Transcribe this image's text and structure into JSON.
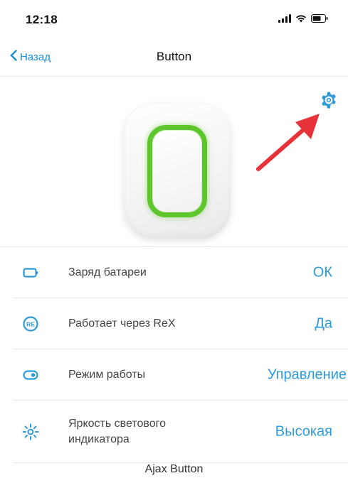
{
  "status_bar": {
    "time": "12:18",
    "icons": [
      "signal-icon",
      "wifi-icon",
      "battery-icon"
    ]
  },
  "nav": {
    "back_label": "Назад",
    "title": "Button"
  },
  "hero": {
    "device_icon": "ajax-button-device",
    "settings_icon": "gear-icon",
    "annotation_icon": "red-arrow-icon"
  },
  "settings": [
    {
      "icon": "battery-outline-icon",
      "label": "Заряд батареи",
      "value": "ОК"
    },
    {
      "icon": "rex-icon",
      "label": "Работает через ReX",
      "value": "Да"
    },
    {
      "icon": "toggle-icon",
      "label": "Режим работы",
      "value": "Управление"
    },
    {
      "icon": "brightness-icon",
      "label": "Яркость светового индикатора",
      "value": "Высокая"
    }
  ],
  "footer": {
    "device_name": "Ajax Button"
  },
  "colors": {
    "accent": "#2d9ad9",
    "ring_green": "#5dc62c",
    "arrow_red": "#e8323a"
  }
}
